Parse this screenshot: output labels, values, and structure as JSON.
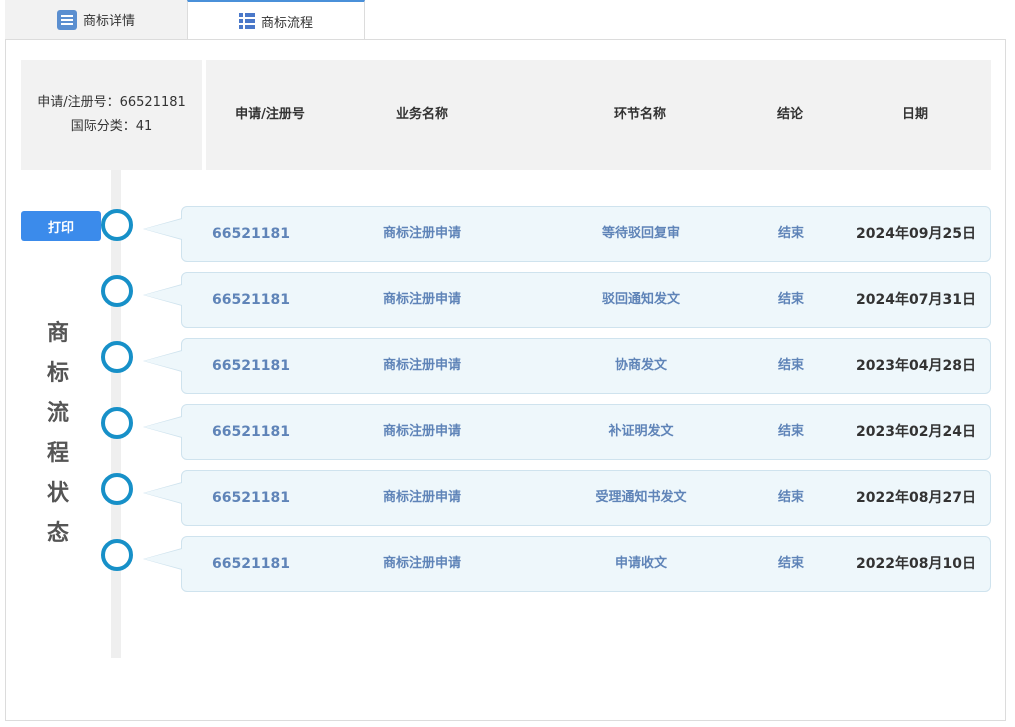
{
  "tabs": [
    {
      "label": "商标详情",
      "icon": "document-list-icon"
    },
    {
      "label": "商标流程",
      "icon": "list-icon"
    }
  ],
  "summary": {
    "reg_no_text": "申请/注册号：66521181",
    "class_text": "国际分类：41"
  },
  "columns": [
    "申请/注册号",
    "业务名称",
    "环节名称",
    "结论",
    "日期"
  ],
  "print_label": "打印",
  "timeline_label": [
    "商",
    "标",
    "流",
    "程",
    "状",
    "态"
  ],
  "rows": [
    {
      "reg_no": "66521181",
      "business": "商标注册申请",
      "step": "等待驳回复审",
      "result": "结束",
      "date": "2024年09月25日"
    },
    {
      "reg_no": "66521181",
      "business": "商标注册申请",
      "step": "驳回通知发文",
      "result": "结束",
      "date": "2024年07月31日"
    },
    {
      "reg_no": "66521181",
      "business": "商标注册申请",
      "step": "协商发文",
      "result": "结束",
      "date": "2023年04月28日"
    },
    {
      "reg_no": "66521181",
      "business": "商标注册申请",
      "step": "补证明发文",
      "result": "结束",
      "date": "2023年02月24日"
    },
    {
      "reg_no": "66521181",
      "business": "商标注册申请",
      "step": "受理通知书发文",
      "result": "结束",
      "date": "2022年08月27日"
    },
    {
      "reg_no": "66521181",
      "business": "商标注册申请",
      "step": "申请收文",
      "result": "结束",
      "date": "2022年08月10日"
    }
  ],
  "colors": {
    "accent": "#3b8beb",
    "timeline_node": "#1790c8",
    "row_bg": "#eef7fb",
    "link_text": "#5f84b8"
  }
}
